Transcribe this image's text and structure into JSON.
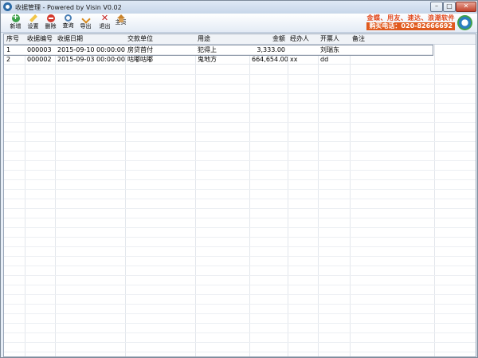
{
  "window": {
    "title": "收据管理 - Powered by Visin V0.02",
    "min_glyph": "–",
    "max_glyph": "□",
    "close_glyph": "✕"
  },
  "toolbar": {
    "buttons": [
      {
        "label": "新增",
        "icon": "add-icon"
      },
      {
        "label": "设置",
        "icon": "pencil-icon"
      },
      {
        "label": "删除",
        "icon": "delete-icon"
      },
      {
        "label": "查询",
        "icon": "search-icon"
      },
      {
        "label": "导出",
        "icon": "export-icon"
      },
      {
        "label": "退出",
        "icon": "exit-icon"
      },
      {
        "label": "主页",
        "icon": "home-icon"
      }
    ],
    "ad_line1": "金蝶、用友、速达、浪潮软件",
    "ad_line2": "购买电话：020-82666692"
  },
  "grid": {
    "headers": [
      "序号",
      "收据编号",
      "收据日期",
      "交款单位",
      "用途",
      "金额",
      "经办人",
      "开票人",
      "备注"
    ],
    "rows": [
      {
        "no": "1",
        "code": "000003",
        "date": "2015-09-10 00:00:00",
        "payer": "房贷首付",
        "purpose": "犯得上",
        "amount": "3,333.00",
        "handler": "",
        "issuer": "刘瑞东",
        "note": ""
      },
      {
        "no": "2",
        "code": "000002",
        "date": "2015-09-03 00:00:00",
        "payer": "咕嘟咕嘟",
        "purpose": "鬼地方",
        "amount": "664,654.00",
        "handler": "xx",
        "issuer": "dd",
        "note": ""
      }
    ]
  },
  "colors": {
    "ad_text": "#e2491d",
    "title_bg": "#c7d6e9"
  }
}
